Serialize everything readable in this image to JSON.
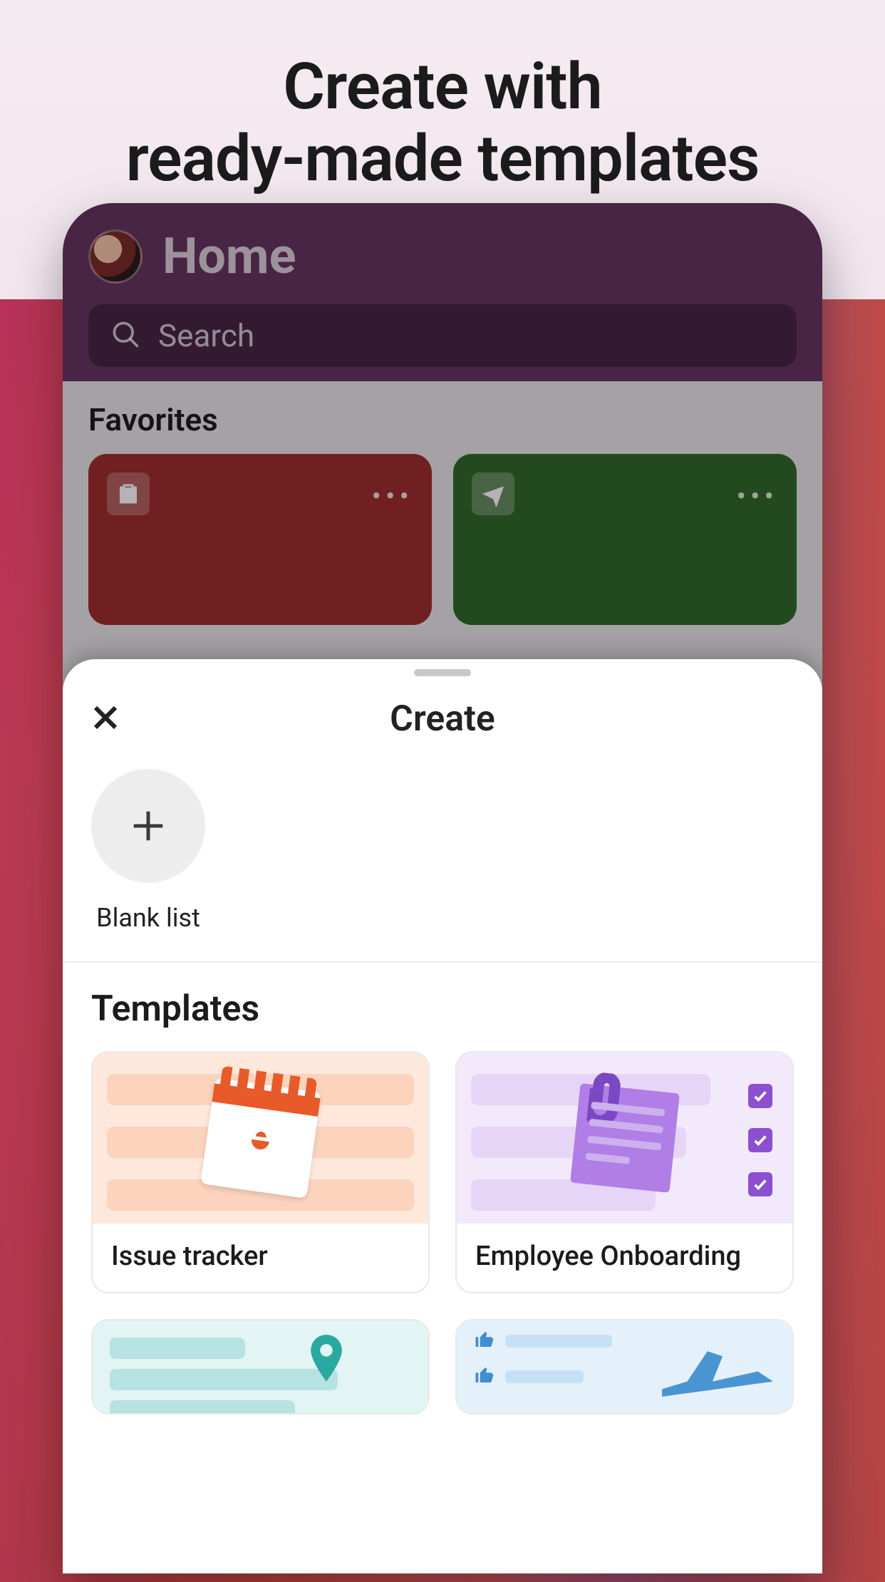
{
  "promo": {
    "line1": "Create with",
    "line2": "ready-made templates"
  },
  "app": {
    "title": "Home",
    "search_placeholder": "Search",
    "favorites_label": "Favorites",
    "fav_more": "•••"
  },
  "sheet": {
    "title": "Create",
    "blank_label": "Blank list",
    "templates_heading": "Templates",
    "templates": [
      {
        "label": "Issue tracker"
      },
      {
        "label": "Employee Onboarding"
      },
      {
        "label": ""
      },
      {
        "label": ""
      }
    ]
  },
  "colors": {
    "fav_red": "#9d2e2a",
    "fav_green": "#2f6b28",
    "accent_purple": "#8b4fcf",
    "accent_orange": "#e85a2a",
    "accent_teal": "#2aa9a0",
    "accent_blue": "#4a95d1"
  }
}
